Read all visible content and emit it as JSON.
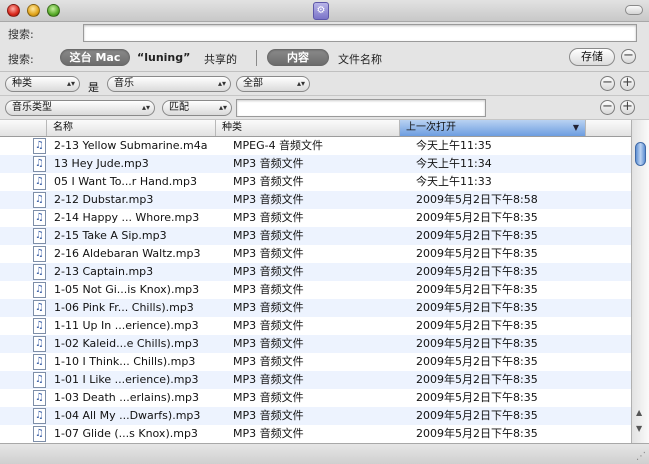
{
  "search": {
    "label": "搜索:",
    "value": ""
  },
  "scope": {
    "label": "搜索:",
    "this_mac": "这台 Mac",
    "luning": "“luning”",
    "shared": "共享的",
    "contents": "内容",
    "filename": "文件名称",
    "save": "存储",
    "minus": "−"
  },
  "rule1": {
    "attribute": "种类",
    "op": "是",
    "value": "音乐",
    "subvalue": "全部",
    "minus": "−",
    "plus": "+"
  },
  "rule2": {
    "attribute": "音乐类型",
    "op": "匹配",
    "value": "",
    "minus": "−",
    "plus": "+"
  },
  "columns": {
    "name": "名称",
    "kind": "种类",
    "date": "上一次打开",
    "sort_arrow": "▼"
  },
  "rows": [
    {
      "name": "2-13 Yellow Submarine.m4a",
      "kind": "MPEG-4 音频文件",
      "date": "今天上午11:35"
    },
    {
      "name": "13 Hey Jude.mp3",
      "kind": "MP3 音频文件",
      "date": "今天上午11:34"
    },
    {
      "name": "05 I Want To...r Hand.mp3",
      "kind": "MP3 音频文件",
      "date": "今天上午11:33"
    },
    {
      "name": "2-12 Dubstar.mp3",
      "kind": "MP3 音频文件",
      "date": "2009年5月2日下午8:58"
    },
    {
      "name": "2-14 Happy ... Whore.mp3",
      "kind": "MP3 音频文件",
      "date": "2009年5月2日下午8:35"
    },
    {
      "name": "2-15 Take A Sip.mp3",
      "kind": "MP3 音频文件",
      "date": "2009年5月2日下午8:35"
    },
    {
      "name": "2-16 Aldebaran Waltz.mp3",
      "kind": "MP3 音频文件",
      "date": "2009年5月2日下午8:35"
    },
    {
      "name": "2-13 Captain.mp3",
      "kind": "MP3 音频文件",
      "date": "2009年5月2日下午8:35"
    },
    {
      "name": "1-05 Not Gi...is Knox).mp3",
      "kind": "MP3 音频文件",
      "date": "2009年5月2日下午8:35"
    },
    {
      "name": "1-06 Pink Fr... Chills).mp3",
      "kind": "MP3 音频文件",
      "date": "2009年5月2日下午8:35"
    },
    {
      "name": "1-11 Up In ...erience).mp3",
      "kind": "MP3 音频文件",
      "date": "2009年5月2日下午8:35"
    },
    {
      "name": "1-02 Kaleid...e Chills).mp3",
      "kind": "MP3 音频文件",
      "date": "2009年5月2日下午8:35"
    },
    {
      "name": "1-10 I Think... Chills).mp3",
      "kind": "MP3 音频文件",
      "date": "2009年5月2日下午8:35"
    },
    {
      "name": "1-01 I Like ...erience).mp3",
      "kind": "MP3 音频文件",
      "date": "2009年5月2日下午8:35"
    },
    {
      "name": "1-03 Death ...erlains).mp3",
      "kind": "MP3 音频文件",
      "date": "2009年5月2日下午8:35"
    },
    {
      "name": "1-04 All My ...Dwarfs).mp3",
      "kind": "MP3 音频文件",
      "date": "2009年5月2日下午8:35"
    },
    {
      "name": "1-07 Glide (...s Knox).mp3",
      "kind": "MP3 音频文件",
      "date": "2009年5月2日下午8:35"
    }
  ],
  "icons": {
    "file": "music-file-icon",
    "close": "close-button",
    "minimize": "minimize-button",
    "zoom": "zoom-button",
    "title": "smart-folder-icon"
  }
}
